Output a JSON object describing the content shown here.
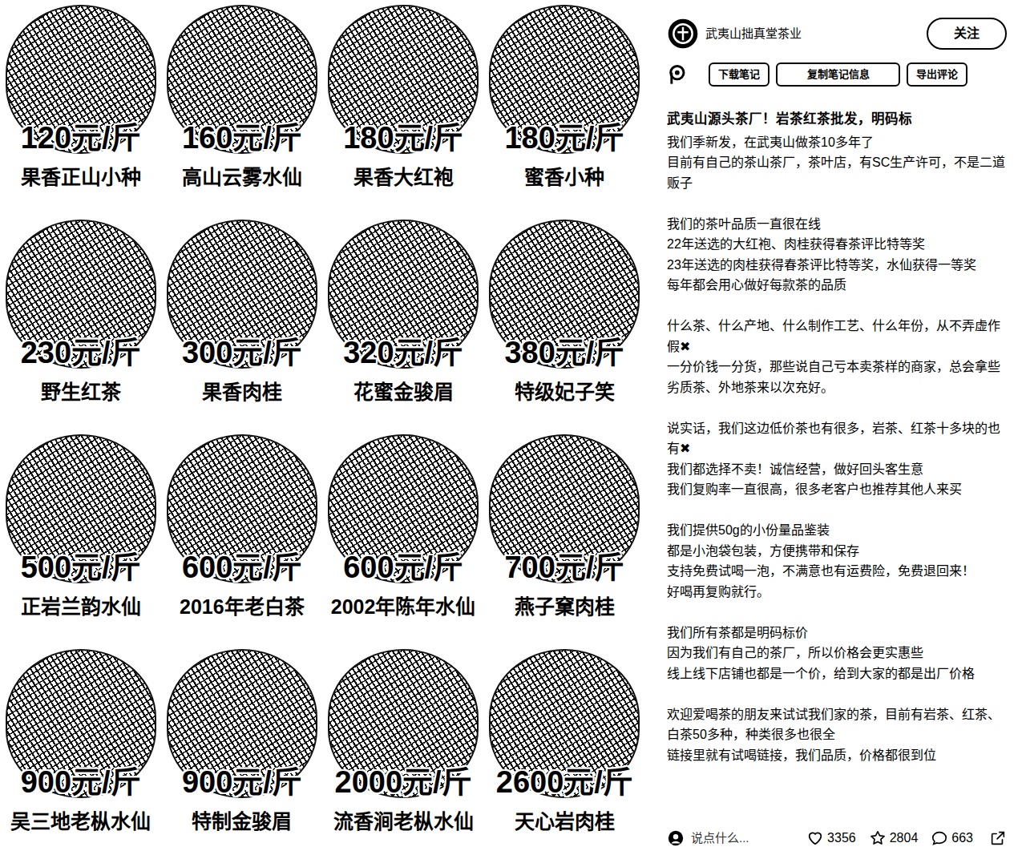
{
  "post_images": {
    "tiles": [
      {
        "price": "120元/斤",
        "name": "果香正山小种"
      },
      {
        "price": "160元/斤",
        "name": "高山云雾水仙"
      },
      {
        "price": "180元/斤",
        "name": "果香大红袍"
      },
      {
        "price": "180元/斤",
        "name": "蜜香小种"
      },
      {
        "price": "230元/斤",
        "name": "野生红茶"
      },
      {
        "price": "300元/斤",
        "name": "果香肉桂"
      },
      {
        "price": "320元/斤",
        "name": "花蜜金骏眉"
      },
      {
        "price": "380元/斤",
        "name": "特级妃子笑"
      },
      {
        "price": "500元/斤",
        "name": "正岩兰韵水仙"
      },
      {
        "price": "600元/斤",
        "name": "2016年老白茶"
      },
      {
        "price": "600元/斤",
        "name": "2002年陈年水仙"
      },
      {
        "price": "700元/斤",
        "name": "燕子窠肉桂"
      },
      {
        "price": "900元/斤",
        "name": "吴三地老枞水仙"
      },
      {
        "price": "900元/斤",
        "name": "特制金骏眉"
      },
      {
        "price": "2000元/斤",
        "name": "流香涧老枞水仙"
      },
      {
        "price": "2600元/斤",
        "name": "天心岩肉桂"
      }
    ]
  },
  "author": {
    "name": "武夷山拙真堂茶业"
  },
  "follow_button": "关注",
  "tools": [
    "下载笔记",
    "复制笔记信息",
    "导出评论"
  ],
  "note": {
    "title": "武夷山源头茶厂！岩茶红茶批发，明码标",
    "paragraphs": [
      [
        "我们季新发，在武夷山做茶10多年了",
        "目前有自己的茶山茶厂，茶叶店，有SC生产许可，不是二道贩子"
      ],
      [
        "我们的茶叶品质一直很在线",
        "22年送选的大红袍、肉桂获得春茶评比特等奖",
        "23年送选的肉桂获得春茶评比特等奖，水仙获得一等奖",
        "每年都会用心做好每款茶的品质"
      ],
      [
        "什么茶、什么产地、什么制作工艺、什么年份，从不弄虚作假✖",
        "一分价钱一分货，那些说自己亏本卖茶样的商家，总会拿些劣质茶、外地茶来以次充好。"
      ],
      [
        "说实话，我们这边低价茶也有很多，岩茶、红茶十多块的也有✖",
        "我们都选择不卖！诚信经营，做好回头客生意",
        "我们复购率一直很高，很多老客户也推荐其他人来买"
      ],
      [
        "我们提供50g的小份量品鉴装",
        "都是小泡袋包装，方便携带和保存",
        "支持免费试喝一泡，不满意也有运费险，免费退回来！",
        "好喝再复购就行。"
      ],
      [
        "我们所有茶都是明码标价",
        "因为我们有自己的茶厂，所以价格会更实惠些",
        "线上线下店铺也都是一个价，给到大家的都是出厂价格"
      ],
      [
        "欢迎爱喝茶的朋友来试试我们家的茶，目前有岩茶、红茶、白茶50多种，种类很多也很全",
        "链接里就有试喝链接，我们品质，价格都很到位"
      ]
    ]
  },
  "footer": {
    "comment_placeholder": "说点什么...",
    "likes": "3356",
    "collects": "2804",
    "comments": "663"
  }
}
